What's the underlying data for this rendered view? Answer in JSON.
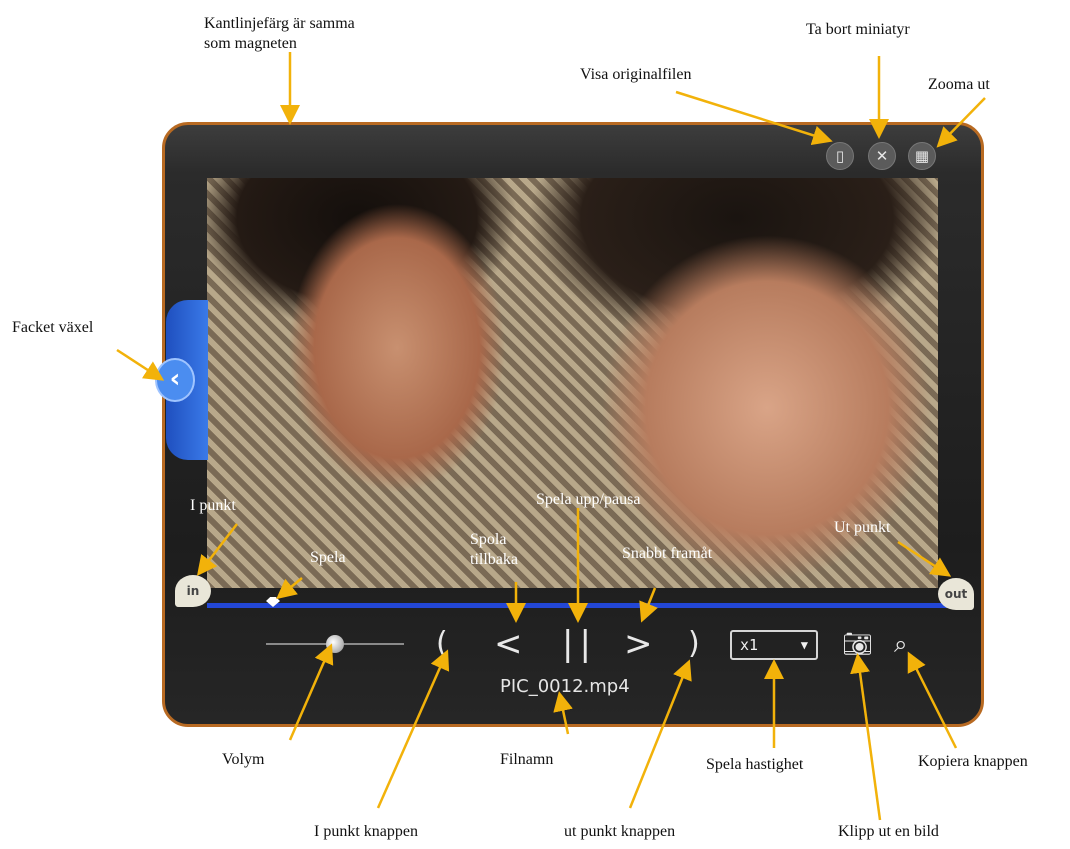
{
  "annotations": {
    "border_color": "Kantlinjefärg är samma\nsom magneten",
    "remove_thumbnail": "Ta bort miniatyr",
    "view_original": "Visa originalfilen",
    "zoom_out": "Zooma ut",
    "drawer_toggle": "Facket växel",
    "in_point": "I punkt",
    "play": "Spela",
    "rewind": "Spola\ntillbaka",
    "play_pause": "Spela upp/pausa",
    "fast_forward": "Snabbt framåt",
    "out_point": "Ut punkt",
    "volume": "Volym",
    "filename": "Filnamn",
    "play_speed": "Spela hastighet",
    "copy_button": "Kopiera knappen",
    "in_point_button": "I punkt knappen",
    "out_point_button": "ut punkt knappen",
    "snapshot": "Klipp ut en bild"
  },
  "player": {
    "in_label": "in",
    "out_label": "out",
    "speed_value": "x1",
    "filename": "PIC_0012.mp4",
    "border_color": "#b86a22",
    "timeline_color": "#2347d6",
    "volume_level": 0.45,
    "playhead_position": 0.09
  },
  "icons": {
    "view_original": "document-icon",
    "remove": "close-icon",
    "zoom_out": "grid-icon",
    "drawer": "chevron-left-icon",
    "in_button": "bracket-left-icon",
    "rewind": "chevron-left-icon",
    "play_pause": "pause-icon",
    "forward": "chevron-right-icon",
    "out_button": "bracket-right-icon",
    "snapshot": "camera-icon",
    "copy": "copy-icon"
  }
}
